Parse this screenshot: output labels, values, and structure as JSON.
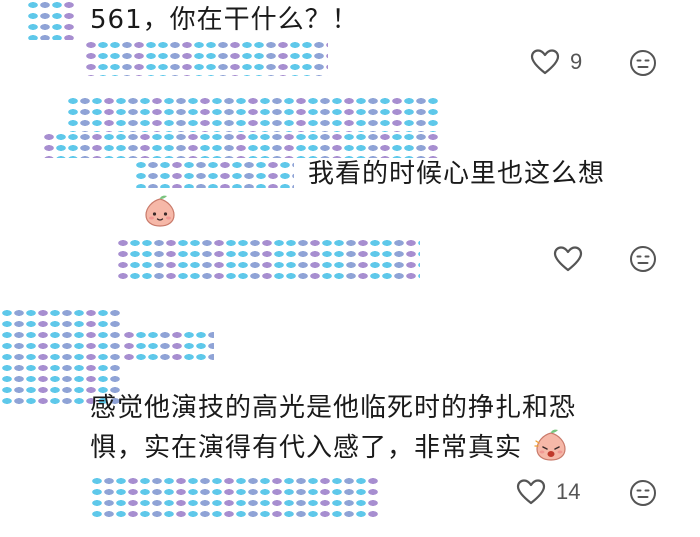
{
  "comments": [
    {
      "text": "561，你在干什么？！",
      "likes": "9"
    },
    {
      "text": "我看的时候心里也这么想",
      "likes": ""
    },
    {
      "text_line1": "感觉他演技的高光是他临死时的挣扎和恐",
      "text_line2": "惧，实在演得有代入感了，非常真实",
      "likes": "14"
    }
  ],
  "icons": {
    "like": "heart-outline-icon",
    "react": "neutral-face-icon",
    "sticker": "peach-face-sticker"
  },
  "colors": {
    "text": "#1a1a1a",
    "icon": "#555555",
    "mosaic_blue": "#5ec8ea",
    "mosaic_purple": "#a78ed0"
  }
}
